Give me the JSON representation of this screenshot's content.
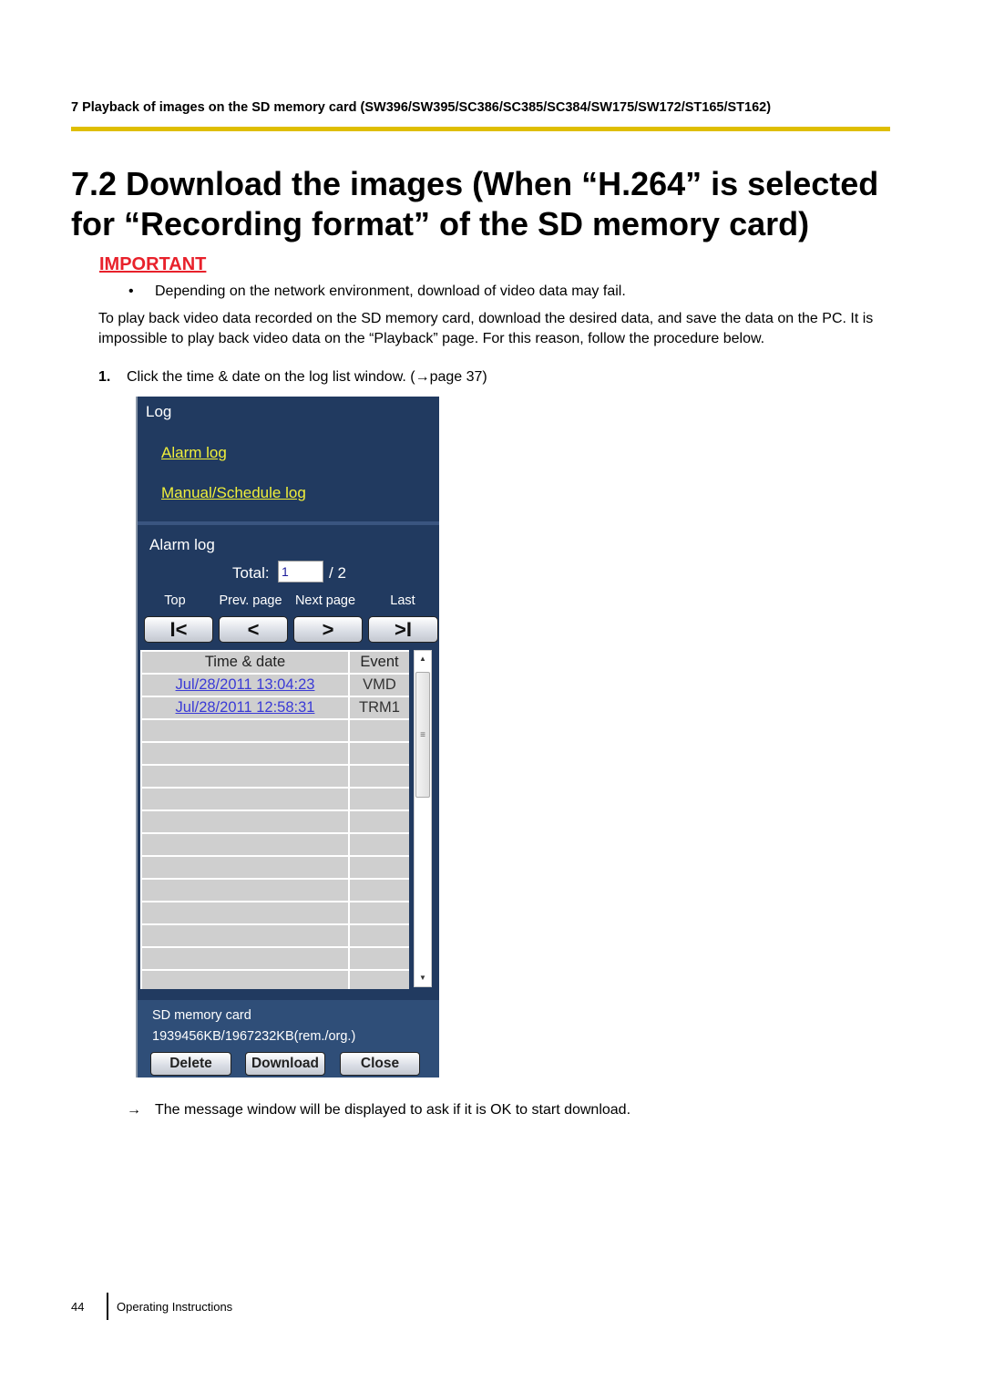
{
  "running_head": "7 Playback of images on the SD memory card (SW396/SW395/SC386/SC385/SC384/SW175/SW172/ST165/ST162)",
  "section_title": "7.2 Download the images (When “H.264” is selected for “Recording format” of the SD memory card)",
  "important": {
    "label": "IMPORTANT",
    "bullet_symbol": "•",
    "bullet_text": "Depending on the network environment, download of video data may fail."
  },
  "intro_paragraph": "To play back video data recorded on the SD memory card, download the desired data, and save the data on the PC. It is impossible to play back video data on the “Playback” page. For this reason, follow the procedure below.",
  "step": {
    "number": "1.",
    "text": "Click the time & date on the log list window. (→page 37)"
  },
  "panel": {
    "log_title": "Log",
    "links": [
      "Alarm log",
      "Manual/Schedule log"
    ],
    "alarm_log_title": "Alarm log",
    "total_label": "Total:",
    "total_value": "1",
    "total_of": "/ 2",
    "nav": [
      {
        "label": "Top",
        "glyph": "I<"
      },
      {
        "label": "Prev. page",
        "glyph": "<"
      },
      {
        "label": "Next page",
        "glyph": ">"
      },
      {
        "label": "Last",
        "glyph": ">I"
      }
    ],
    "table": {
      "headers": [
        "Time & date",
        "Event"
      ],
      "rows": [
        {
          "datetime": "Jul/28/2011 13:04:23",
          "event": "VMD"
        },
        {
          "datetime": "Jul/28/2011 12:58:31",
          "event": "TRM1"
        },
        {
          "datetime": "",
          "event": ""
        },
        {
          "datetime": "",
          "event": ""
        },
        {
          "datetime": "",
          "event": ""
        },
        {
          "datetime": "",
          "event": ""
        },
        {
          "datetime": "",
          "event": ""
        },
        {
          "datetime": "",
          "event": ""
        },
        {
          "datetime": "",
          "event": ""
        },
        {
          "datetime": "",
          "event": ""
        },
        {
          "datetime": "",
          "event": ""
        },
        {
          "datetime": "",
          "event": ""
        },
        {
          "datetime": "",
          "event": ""
        },
        {
          "datetime": "",
          "event": ""
        }
      ]
    },
    "sd_label": "SD memory card",
    "sd_value": "1939456KB/1967232KB(rem./org.)",
    "buttons": {
      "delete": "Delete",
      "download": "Download",
      "close": "Close"
    }
  },
  "result": {
    "arrow": "→",
    "text": "The message window will be displayed to ask if it is OK to start download."
  },
  "footer": {
    "page_number": "44",
    "text": "Operating Instructions"
  },
  "colors": {
    "accent_rule": "#dfbe00",
    "important": "#e8212b",
    "panel_bg": "#213a60",
    "link_yellow": "#f0ef3a",
    "link_blue": "#3a3ad6"
  }
}
